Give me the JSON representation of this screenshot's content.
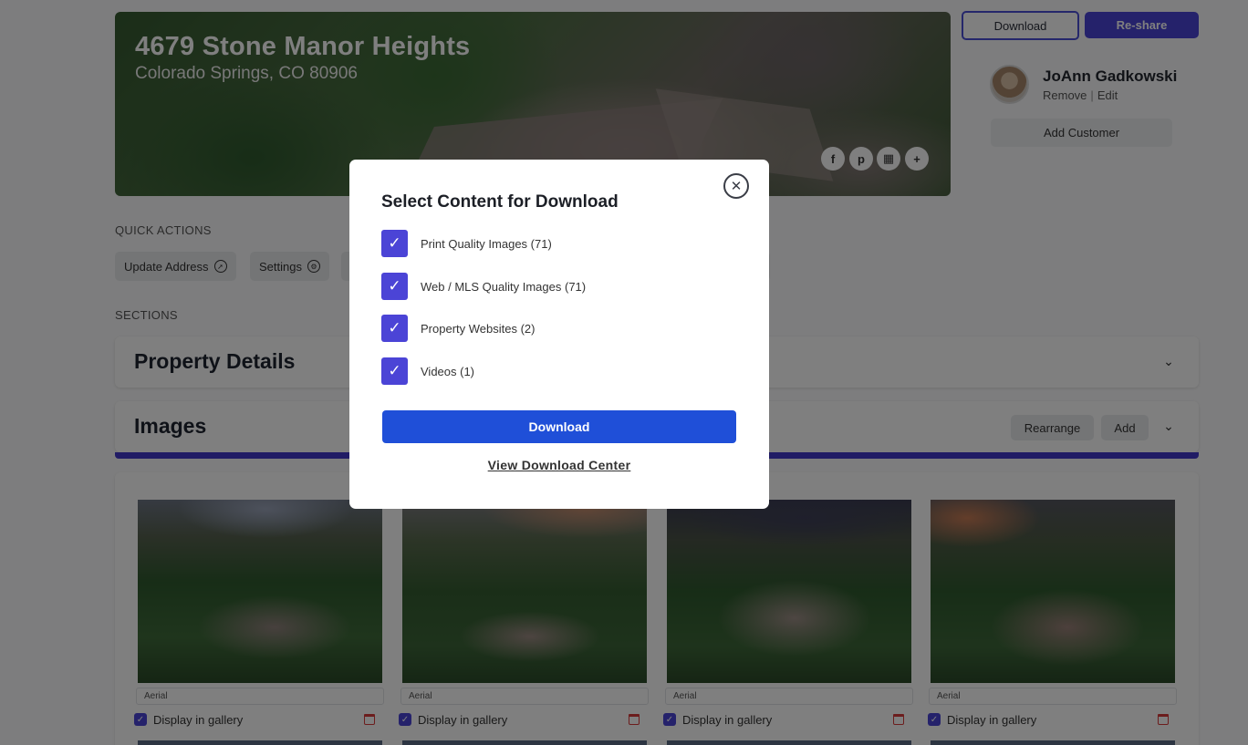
{
  "property": {
    "address": "4679 Stone Manor Heights",
    "city_line": "Colorado Springs, CO 80906"
  },
  "social": [
    {
      "icon": "facebook-icon",
      "glyph": "f"
    },
    {
      "icon": "pinterest-icon",
      "glyph": "p"
    },
    {
      "icon": "qr-code-icon",
      "glyph": "▦"
    },
    {
      "icon": "plus-icon",
      "glyph": "+"
    }
  ],
  "top_actions": {
    "download": "Download",
    "reshare": "Re-share"
  },
  "customer": {
    "name": "JoAnn Gadkowski",
    "remove": "Remove",
    "separator": "|",
    "edit": "Edit",
    "add_customer": "Add Customer"
  },
  "quick_actions": {
    "heading": "QUICK ACTIONS",
    "update_address": "Update Address",
    "settings": "Settings"
  },
  "sections": {
    "heading": "SECTIONS",
    "property_details": "Property Details",
    "images": "Images",
    "rearrange": "Rearrange",
    "add": "Add"
  },
  "images": [
    {
      "category": "Aerial",
      "gallery_label": "Display in gallery",
      "display_in_gallery": true
    },
    {
      "category": "Aerial",
      "gallery_label": "Display in gallery",
      "display_in_gallery": true
    },
    {
      "category": "Aerial",
      "gallery_label": "Display in gallery",
      "display_in_gallery": true
    },
    {
      "category": "Aerial",
      "gallery_label": "Display in gallery",
      "display_in_gallery": true
    }
  ],
  "modal": {
    "title": "Select Content for Download",
    "options": [
      {
        "label": "Print Quality Images (71)",
        "checked": true
      },
      {
        "label": "Web / MLS Quality Images (71)",
        "checked": true
      },
      {
        "label": "Property Websites (2)",
        "checked": true
      },
      {
        "label": "Videos (1)",
        "checked": true
      }
    ],
    "download_button": "Download",
    "view_center_link": "View Download Center"
  },
  "colors": {
    "accent": "#4b44d6",
    "primary_button": "#1f4fd8",
    "images_bar": "#4338ca",
    "delete": "#d93b3b"
  }
}
